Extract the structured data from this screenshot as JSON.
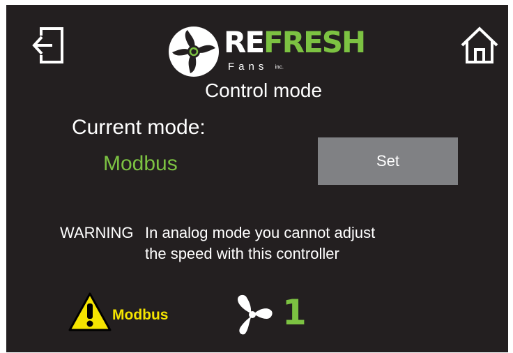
{
  "header": {
    "exit_icon": "exit-door-icon",
    "home_icon": "home-icon",
    "logo": {
      "brand_part1": "RE",
      "brand_part2": "FRESH",
      "sub_text": "Fans",
      "sub_suffix": "inc."
    }
  },
  "page": {
    "title": "Control mode"
  },
  "mode": {
    "current_label": "Current mode:",
    "current_value": "Modbus",
    "set_button_label": "Set"
  },
  "warning": {
    "label": "WARNING",
    "line1": "In analog mode you cannot adjust",
    "line2": "the speed with this controller"
  },
  "status_bar": {
    "warning_icon": "warning-triangle-icon",
    "mode_text": "Modbus",
    "fan_icon": "fan-icon",
    "speed_value": "1"
  },
  "colors": {
    "background": "#231f20",
    "accent_green": "#7cc242",
    "warning_yellow": "#f5e400",
    "button_gray": "#808184",
    "text": "#ffffff"
  }
}
